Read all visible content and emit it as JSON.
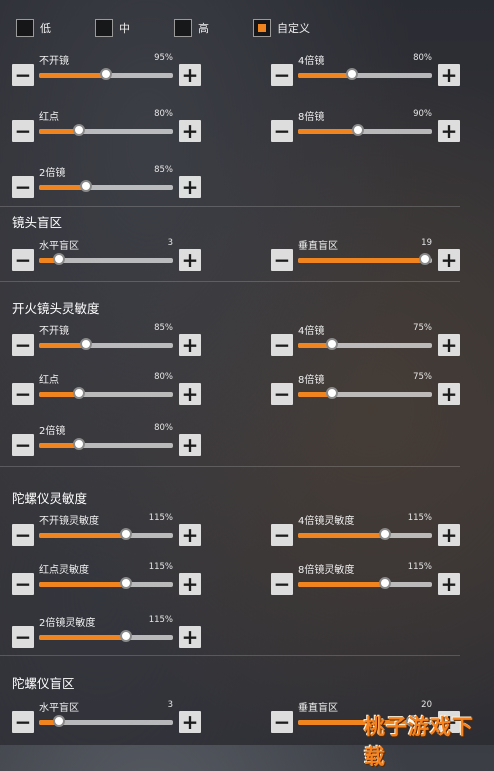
{
  "presets": [
    {
      "label": "低",
      "checked": false
    },
    {
      "label": "中",
      "checked": false
    },
    {
      "label": "高",
      "checked": false
    },
    {
      "label": "自定义",
      "checked": true
    }
  ],
  "sections": [
    {
      "title": ""
    },
    {
      "title": "镜头盲区"
    },
    {
      "title": "开火镜头灵敏度"
    },
    {
      "title": "陀螺仪灵敏度"
    },
    {
      "title": "陀螺仪盲区"
    }
  ],
  "sliders": [
    {
      "label": "不开镜",
      "value": "95%",
      "level": 0.5
    },
    {
      "label": "4倍镜",
      "value": "80%",
      "level": 0.4
    },
    {
      "label": "红点",
      "value": "80%",
      "level": 0.3
    },
    {
      "label": "8倍镜",
      "value": "90%",
      "level": 0.45
    },
    {
      "label": "2倍镜",
      "value": "85%",
      "level": 0.35
    },
    {
      "label": "水平盲区",
      "value": "3",
      "level": 0.15
    },
    {
      "label": "垂直盲区",
      "value": "19",
      "level": 0.95
    },
    {
      "label": "不开镜",
      "value": "85%",
      "level": 0.35
    },
    {
      "label": "4倍镜",
      "value": "75%",
      "level": 0.25
    },
    {
      "label": "红点",
      "value": "80%",
      "level": 0.3
    },
    {
      "label": "8倍镜",
      "value": "75%",
      "level": 0.25
    },
    {
      "label": "2倍镜",
      "value": "80%",
      "level": 0.3
    },
    {
      "label": "不开镜灵敏度",
      "value": "115%",
      "level": 0.65
    },
    {
      "label": "4倍镜灵敏度",
      "value": "115%",
      "level": 0.65
    },
    {
      "label": "红点灵敏度",
      "value": "115%",
      "level": 0.65
    },
    {
      "label": "8倍镜灵敏度",
      "value": "115%",
      "level": 0.65
    },
    {
      "label": "2倍镜灵敏度",
      "value": "115%",
      "level": 0.65
    },
    {
      "label": "水平盲区",
      "value": "3",
      "level": 0.15
    },
    {
      "label": "垂直盲区",
      "value": "20",
      "level": 0.85
    }
  ],
  "buttons": {
    "minus": "−",
    "plus": "+"
  },
  "watermark": "桃子游戏下载",
  "colors": {
    "accent": "#f0851f",
    "track": "#e6e6e6",
    "button_bg": "#ebebeb"
  }
}
